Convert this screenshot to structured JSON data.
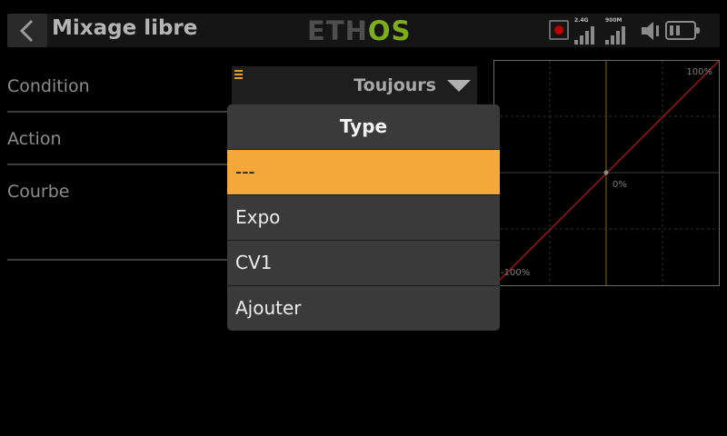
{
  "header": {
    "title": "Mixage libre",
    "logo_left": "ETH",
    "logo_right": "OS",
    "status": {
      "rf_24_label": "2.4G",
      "rf_900_label": "900M"
    }
  },
  "form": {
    "rows": [
      {
        "label": "Condition"
      },
      {
        "label": "Action"
      },
      {
        "label": "Courbe"
      }
    ],
    "condition_value": "Toujours"
  },
  "graph": {
    "max_label": "100%",
    "mid_label": "0%",
    "min_label": "-100%"
  },
  "popup": {
    "title": "Type",
    "options": [
      {
        "label": "---",
        "selected": true
      },
      {
        "label": "Expo",
        "selected": false
      },
      {
        "label": "CV1",
        "selected": false
      },
      {
        "label": "Ajouter",
        "selected": false
      }
    ]
  },
  "colors": {
    "accent": "#f5a83a",
    "logo_green": "#7cad1a",
    "curve_line": "#a01818",
    "record_red": "#c00000"
  }
}
